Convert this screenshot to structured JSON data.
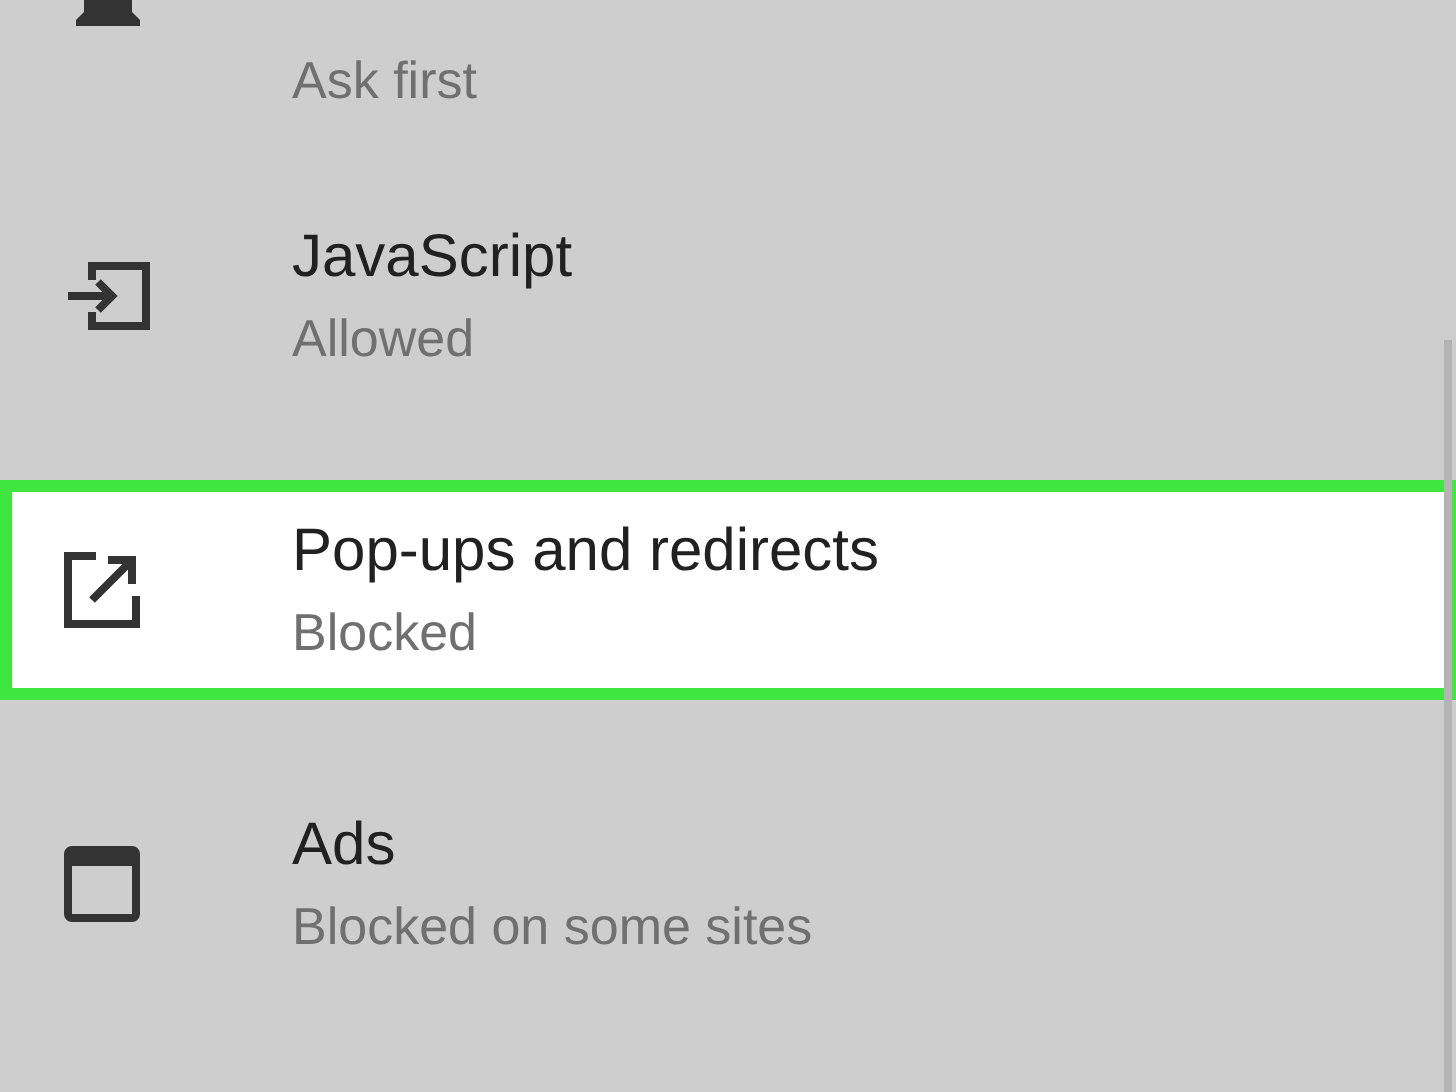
{
  "settings_list": [
    {
      "subtitle": "Ask first",
      "highlighted": false
    },
    {
      "title": "JavaScript",
      "subtitle": "Allowed",
      "highlighted": false
    },
    {
      "title": "Pop-ups and redirects",
      "subtitle": "Blocked",
      "highlighted": true
    },
    {
      "title": "Ads",
      "subtitle": "Blocked on some sites",
      "highlighted": false
    }
  ]
}
